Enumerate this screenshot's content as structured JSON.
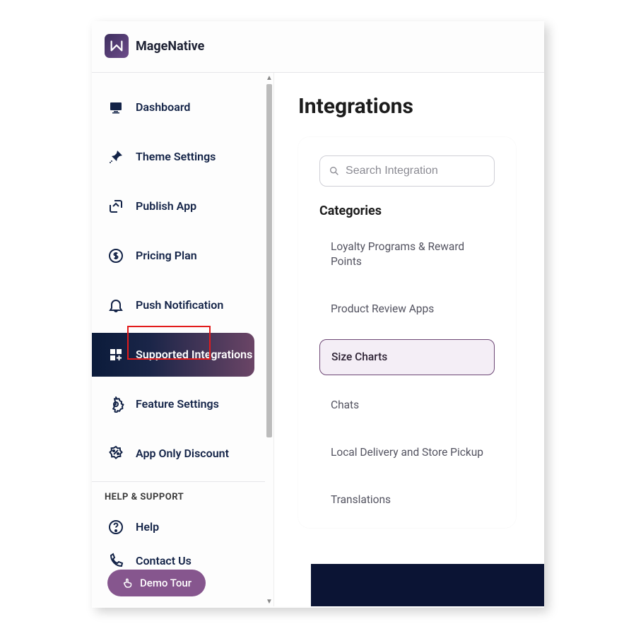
{
  "brand": "MageNative",
  "sidebar": {
    "items": [
      {
        "label": "Dashboard"
      },
      {
        "label": "Theme Settings"
      },
      {
        "label": "Publish App"
      },
      {
        "label": "Pricing Plan"
      },
      {
        "label": "Push Notification"
      },
      {
        "label": "Supported Integrations"
      },
      {
        "label": "Feature Settings"
      },
      {
        "label": "App Only Discount"
      }
    ],
    "section_label": "HELP & SUPPORT",
    "help_items": [
      {
        "label": "Help"
      },
      {
        "label": "Contact Us"
      }
    ]
  },
  "demo_tour_label": "Demo Tour",
  "main": {
    "title": "Integrations",
    "search_placeholder": "Search Integration",
    "categories_heading": "Categories",
    "categories": [
      {
        "label": "Loyalty Programs & Reward Points"
      },
      {
        "label": "Product Review Apps"
      },
      {
        "label": "Size Charts"
      },
      {
        "label": "Chats"
      },
      {
        "label": "Local Delivery and Store Pickup"
      },
      {
        "label": "Translations"
      }
    ]
  }
}
